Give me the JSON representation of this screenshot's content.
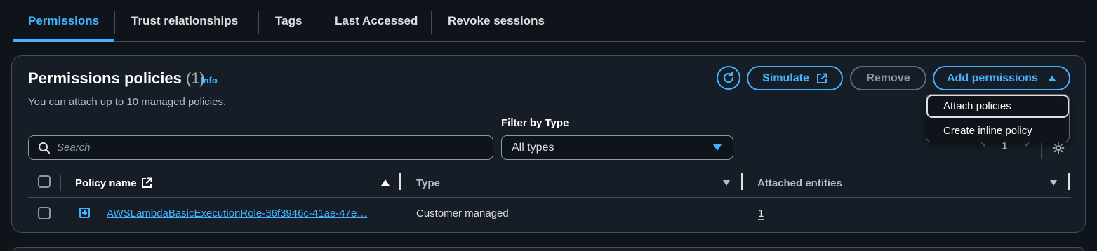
{
  "tabs": [
    {
      "label": "Permissions",
      "active": true
    },
    {
      "label": "Trust relationships"
    },
    {
      "label": "Tags"
    },
    {
      "label": "Last Accessed"
    },
    {
      "label": "Revoke sessions"
    }
  ],
  "panel": {
    "title": "Permissions policies",
    "count": "(1)",
    "info_label": "Info",
    "subtitle": "You can attach up to 10 managed policies."
  },
  "toolbar": {
    "refresh_icon": "refresh-icon",
    "simulate_label": "Simulate",
    "remove_label": "Remove",
    "add_permissions_label": "Add permissions"
  },
  "menu": {
    "items": [
      "Attach policies",
      "Create inline policy"
    ]
  },
  "filter": {
    "search_placeholder": "Search",
    "type_label": "Filter by Type",
    "type_value": "All types"
  },
  "pagination": {
    "page": "1"
  },
  "table": {
    "columns": [
      "Policy name",
      "Type",
      "Attached entities"
    ],
    "rows": [
      {
        "policy_name": "AWSLambdaBasicExecutionRole-36f3946c-41ae-47e…",
        "type": "Customer managed",
        "attached_entities": "1"
      }
    ]
  },
  "colors": {
    "accent": "#42b4ff",
    "background": "#0f141a",
    "panel": "#161d26",
    "border": "#414d5c"
  }
}
